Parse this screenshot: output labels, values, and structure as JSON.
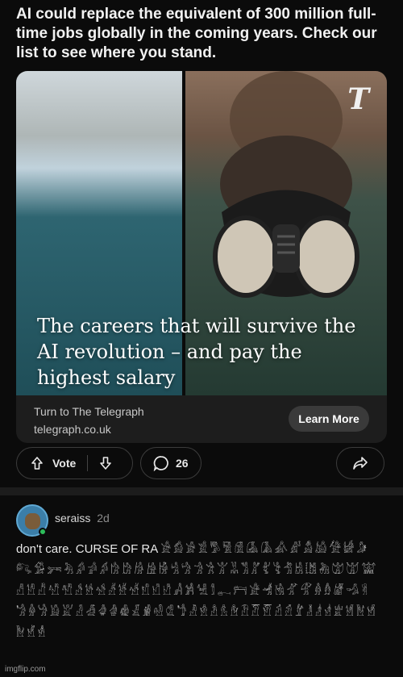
{
  "post": {
    "headline": "AI could replace the equivalent of 300 million full-time jobs globally in the coming years. Check our list to see where you stand."
  },
  "ad": {
    "overlay_title": "The careers that will survive the AI revolution – and pay the highest salary",
    "logo_letter": "T",
    "source": "Turn to The Telegraph",
    "domain": "telegraph.co.uk",
    "cta_label": "Learn More"
  },
  "actions": {
    "vote_label": "Vote",
    "comment_count": "26",
    "icons": [
      "arrow-up-icon",
      "arrow-down-icon",
      "comment-icon",
      "share-icon"
    ]
  },
  "comment": {
    "username": "seraiss",
    "time": "2d",
    "text_prefix": "don't care. CURSE OF RA ",
    "glyphs": "𓀀𓀁𓀂𓀃𓀄𓀅𓀆𓀇𓀈𓀉𓀊𓀋𓀌𓀍𓀎𓀏𓀐𓀑𓀒𓀓𓀔𓀕𓀖𓀗𓀘𓀙𓀚𓀛𓀜𓀝𓀞𓀟𓀠𓀡𓀢𓀣𓀤𓀥𓀦𓀧𓀨𓀩𓀪𓀫𓀬𓀭𓀮𓀯𓀰𓀱𓀲𓀳𓀴𓀵𓀶𓀷𓀸𓀹𓀺𓀻𓀼𓀽𓀾𓀿𓁀𓁁𓁂𓁃𓁄𓁅𓁆𓁇𓁈𓁉𓁊𓁋𓁌𓁍𓁎𓁏𓁐𓁑𓁒𓁓𓁔𓁕𓁖𓁗𓁘𓁙𓁚𓁛𓁜𓁝𓁞𓁟𓁠𓁡𓁢𓁣𓁤𓁥𓁦𓁧𓁨𓁩𓁪𓁫𓁬𓁭𓁮"
  },
  "watermark": "imgflip.com",
  "colors": {
    "background": "#0b0b0b",
    "card": "#1d1d1d",
    "button": "#3a3a3a",
    "online": "#2dbd5a",
    "avatar_ring": "#5fa8d3"
  }
}
